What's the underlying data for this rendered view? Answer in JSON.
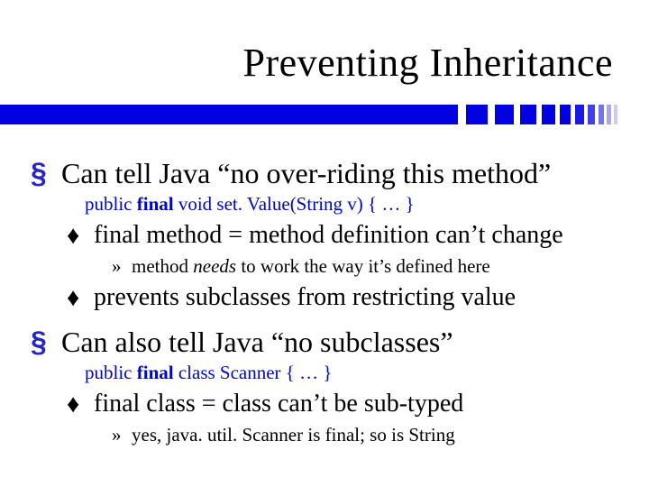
{
  "title": "Preventing Inheritance",
  "bullets": {
    "b1a": "Can tell Java “no over-riding this method”",
    "code1": {
      "pre": "public ",
      "kw": "final",
      "post": " void set. Value(String v) { … }"
    },
    "b2a": "final method = method definition can’t change",
    "b3a_pre": "method ",
    "b3a_em": "needs",
    "b3a_post": " to work the way it’s defined here",
    "b2b": "prevents subclasses from restricting value",
    "b1b": "Can also tell Java “no subclasses”",
    "code2": {
      "pre": "public ",
      "kw": "final",
      "post": " class Scanner { … }"
    },
    "b2c": "final class =  class can’t be sub-typed",
    "b3b": "yes, java. util. Scanner is final; so is String"
  },
  "markers": {
    "l1": "§",
    "l2": "♦",
    "l3": "»"
  }
}
